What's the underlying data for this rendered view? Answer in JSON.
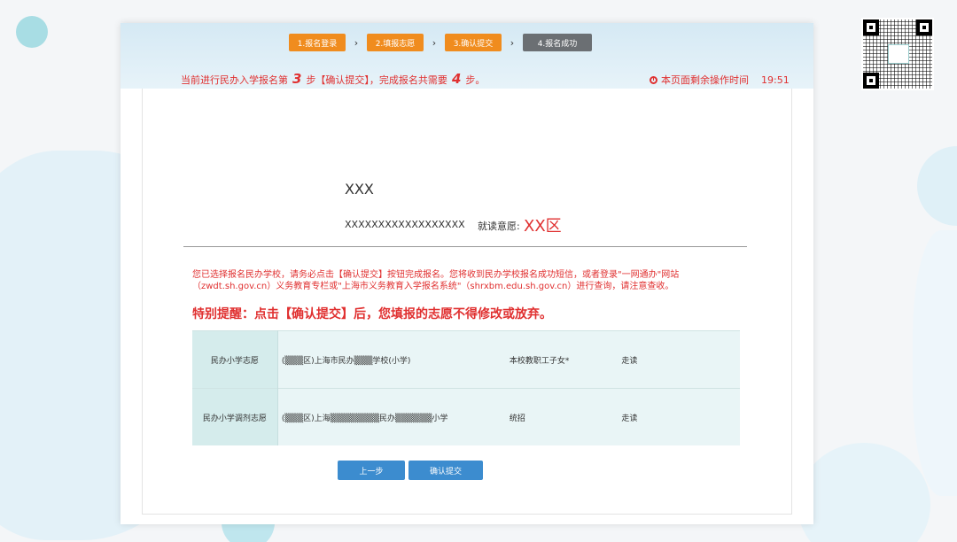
{
  "steps": [
    {
      "label": "1.报名登录",
      "state": "done"
    },
    {
      "label": "2.填报志愿",
      "state": "done"
    },
    {
      "label": "3.确认提交",
      "state": "done"
    },
    {
      "label": "4.报名成功",
      "state": "current"
    }
  ],
  "status": {
    "prefix": "当前进行民办入学报名第",
    "current_step": "3",
    "middle": "步【确认提交】，完成报名共需要",
    "total_steps": "4",
    "suffix": "步。"
  },
  "timer": {
    "label": "本页面剩余操作时间",
    "value": "19:51"
  },
  "student": {
    "name": "XXX",
    "id": "XXXXXXXXXXXXXXXXXX",
    "intent_label": "就读意愿:",
    "intent_value": "XX区"
  },
  "notice": {
    "line1": "您已选择报名民办学校，请务必点击【确认提交】按钮完成报名。您将收到民办学校报名成功短信，或者登录\"一网通办\"网站",
    "line2": "（zwdt.sh.gov.cn）义务教育专栏或\"上海市义务教育入学报名系统\"（shrxbm.edu.sh.gov.cn）进行查询，请注意查收。"
  },
  "warning": "特别提醒：点击【确认提交】后，您填报的志愿不得修改或放弃。",
  "choices": [
    {
      "label": "民办小学志愿",
      "school": "(▒▒▒区)上海市民办▒▒▒学校(小学)",
      "category": "本校教职工子女*",
      "mode": "走读"
    },
    {
      "label": "民办小学调剂志愿",
      "school": "(▒▒▒区)上海▒▒▒▒▒▒▒▒民办▒▒▒▒▒▒小学",
      "category": "统招",
      "mode": "走读"
    }
  ],
  "buttons": {
    "prev": "上一步",
    "submit": "确认提交"
  },
  "colors": {
    "step_done": "#f08c1e",
    "step_current": "#6b6f73",
    "alert": "#e03030",
    "button": "#3c8ccf"
  },
  "icons": {
    "timer": "clock-icon",
    "qr": "qr-code"
  }
}
